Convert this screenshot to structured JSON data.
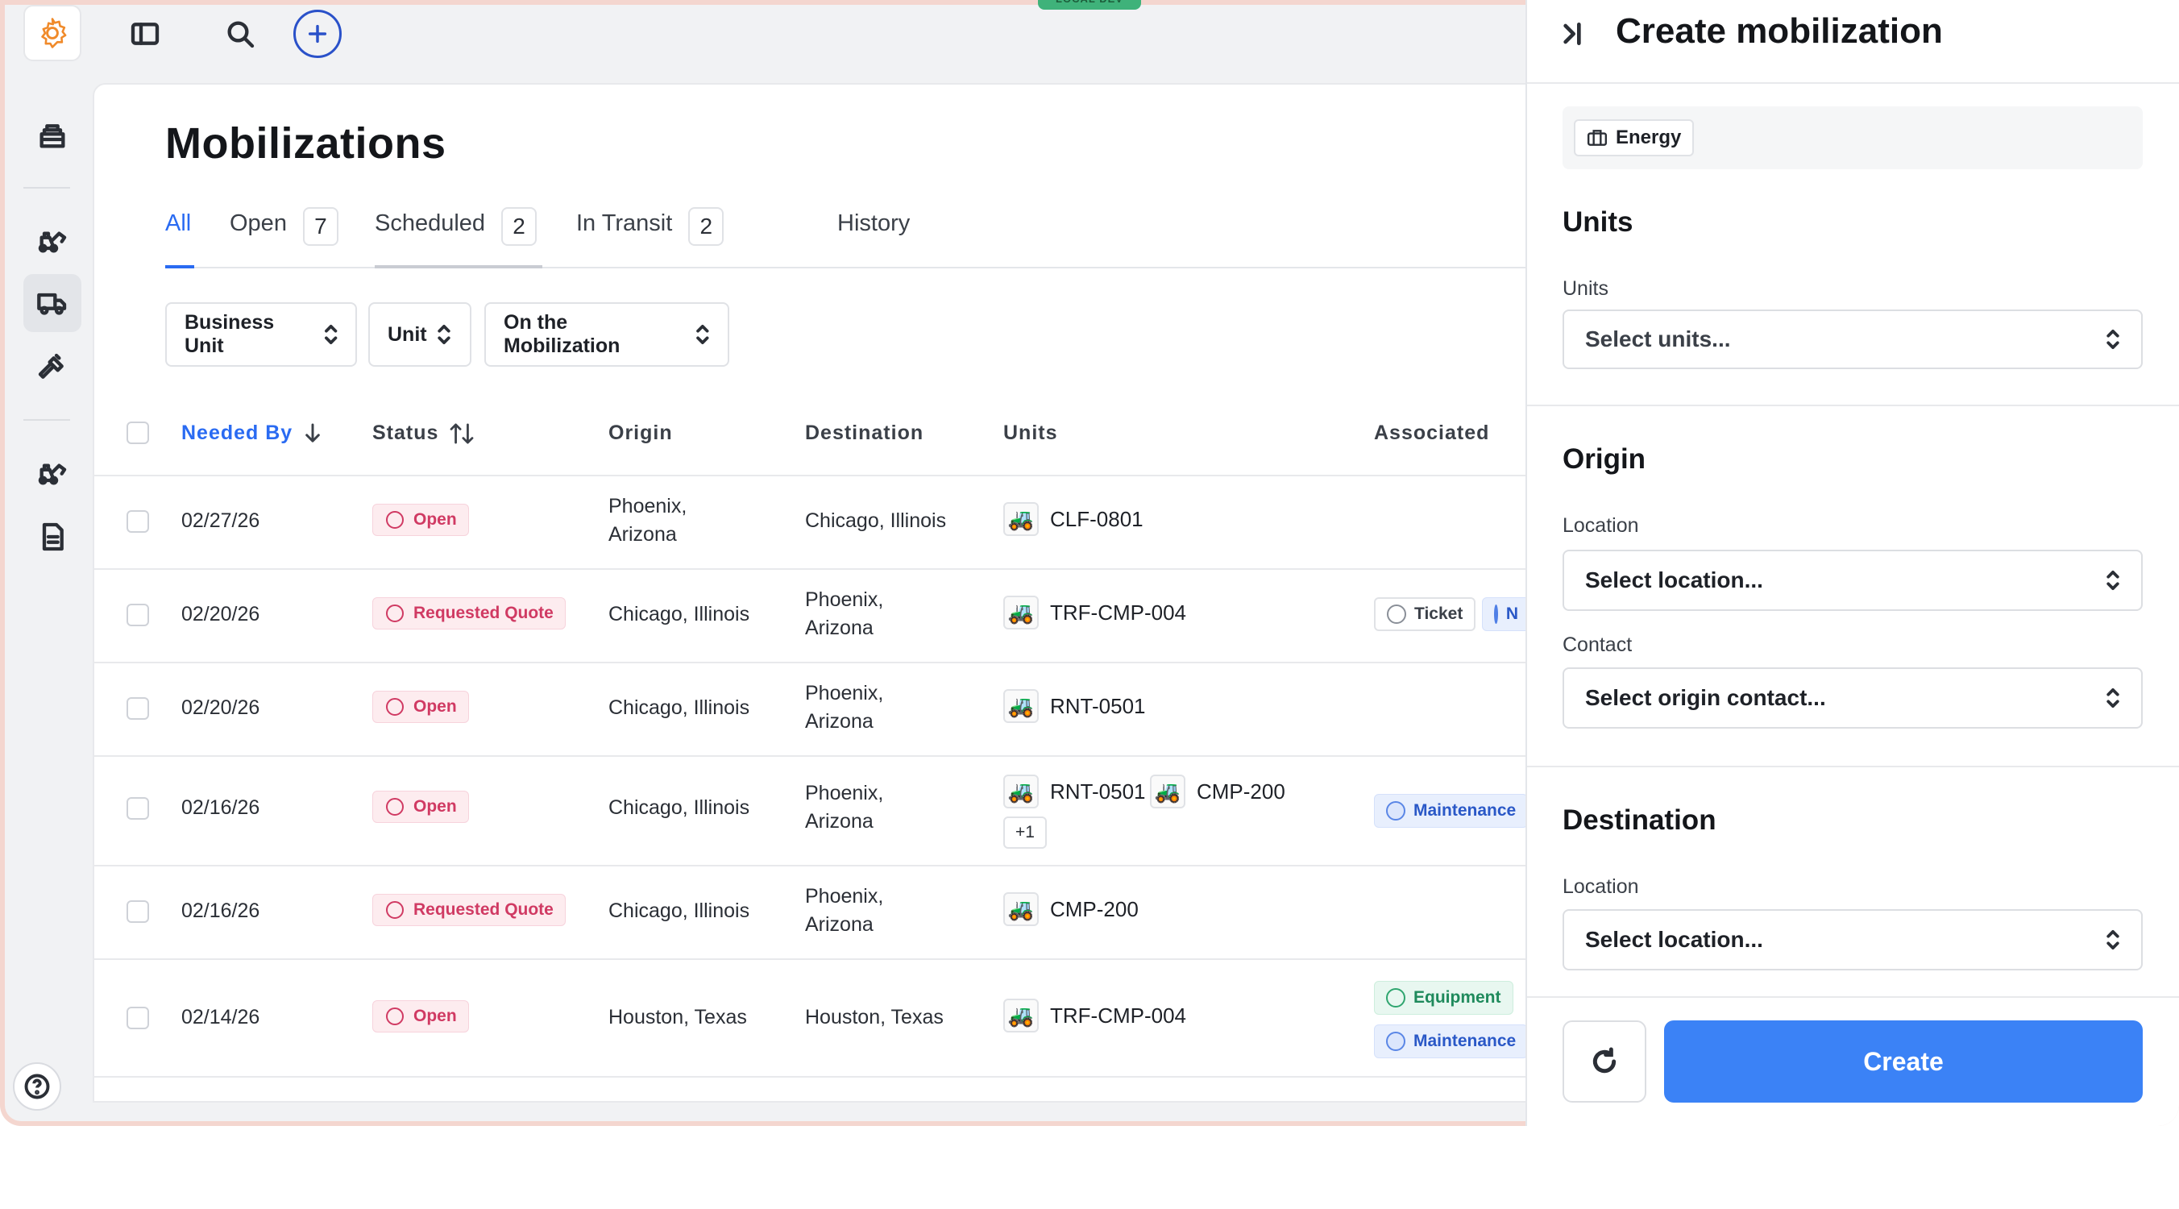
{
  "env_badge": "LOCAL DEV",
  "page": {
    "title": "Mobilizations"
  },
  "tabs": [
    {
      "label": "All"
    },
    {
      "label": "Open",
      "count": "7"
    },
    {
      "label": "Scheduled",
      "count": "2"
    },
    {
      "label": "In Transit",
      "count": "2"
    },
    {
      "label": "History"
    }
  ],
  "filters": [
    "Business Unit",
    "Unit",
    "On the Mobilization"
  ],
  "columns": [
    "Needed By",
    "Status",
    "Origin",
    "Destination",
    "Units",
    "Associated"
  ],
  "rows": [
    {
      "needed_by": "02/27/26",
      "status": "Open",
      "origin": [
        "Phoenix,",
        "Arizona"
      ],
      "destination": [
        "Chicago, Illinois"
      ],
      "units": [
        "CLF-0801"
      ],
      "associated": []
    },
    {
      "needed_by": "02/20/26",
      "status": "Requested Quote",
      "origin": [
        "Chicago, Illinois"
      ],
      "destination": [
        "Phoenix,",
        "Arizona"
      ],
      "units": [
        "TRF-CMP-004"
      ],
      "associated": [
        "Ticket",
        "N"
      ]
    },
    {
      "needed_by": "02/20/26",
      "status": "Open",
      "origin": [
        "Chicago, Illinois"
      ],
      "destination": [
        "Phoenix,",
        "Arizona"
      ],
      "units": [
        "RNT-0501"
      ],
      "associated": []
    },
    {
      "needed_by": "02/16/26",
      "status": "Open",
      "origin": [
        "Chicago, Illinois"
      ],
      "destination": [
        "Phoenix,",
        "Arizona"
      ],
      "units": [
        "RNT-0501",
        "CMP-200"
      ],
      "more": "+1",
      "associated": [
        "Maintenance"
      ]
    },
    {
      "needed_by": "02/16/26",
      "status": "Requested Quote",
      "origin": [
        "Chicago, Illinois"
      ],
      "destination": [
        "Phoenix,",
        "Arizona"
      ],
      "units": [
        "CMP-200"
      ],
      "associated": []
    },
    {
      "needed_by": "02/14/26",
      "status": "Open",
      "origin": [
        "Houston, Texas"
      ],
      "destination": [
        "Houston, Texas"
      ],
      "units": [
        "TRF-CMP-004"
      ],
      "associated": [
        "Equipment",
        "Maintenance"
      ]
    }
  ],
  "panel": {
    "title": "Create mobilization",
    "business_unit": "Energy",
    "units_section": "Units",
    "units_label": "Units",
    "units_placeholder": "Select units...",
    "origin_section": "Origin",
    "origin_location_label": "Location",
    "origin_location_placeholder": "Select location...",
    "origin_contact_label": "Contact",
    "origin_contact_placeholder": "Select origin contact...",
    "destination_section": "Destination",
    "destination_location_label": "Location",
    "destination_location_placeholder": "Select location...",
    "create_label": "Create"
  },
  "colors": {
    "accent": "#2a6bf2",
    "primary_button": "#3b82f6",
    "status_open": "#d03a63",
    "maintenance": "#2a58c7",
    "equipment": "#1f8a5c"
  }
}
